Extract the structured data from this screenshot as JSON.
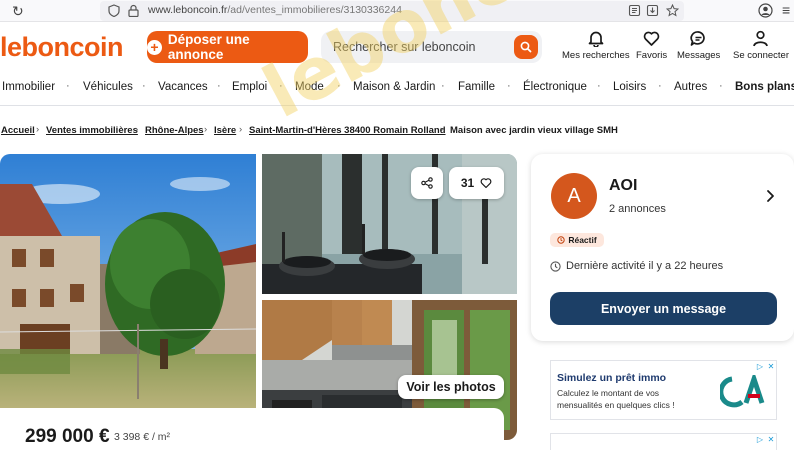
{
  "browser": {
    "url_host": "www.leboncoin.fr",
    "url_path": "/ad/ventes_immobilieres/3130336244"
  },
  "header": {
    "logo": "leboncoin",
    "post_button": "Déposer une annonce",
    "search_placeholder": "Rechercher sur leboncoin",
    "nav": {
      "searches": "Mes recherches",
      "favorites": "Favoris",
      "messages": "Messages",
      "login": "Se connecter"
    }
  },
  "categories": [
    "Immobilier",
    "Véhicules",
    "Vacances",
    "Emploi",
    "Mode",
    "Maison & Jardin",
    "Famille",
    "Électronique",
    "Loisirs",
    "Autres",
    "Bons plans !"
  ],
  "breadcrumb": [
    "Accueil",
    "Ventes immobilières",
    "Rhône-Alpes",
    "Isère",
    "Saint-Martin-d'Hères 38400 Romain Rolland",
    "Maison avec jardin vieux village SMH"
  ],
  "gallery": {
    "favorites_count": "31",
    "see_photos": "Voir les photos"
  },
  "listing": {
    "price": "299 000 €",
    "price_per_m2": "3 398 € / m²"
  },
  "seller": {
    "avatar_letter": "A",
    "name": "AOI",
    "ads_count": "2 annonces",
    "badge": "Réactif",
    "last_activity": "Dernière activité il y a 22 heures",
    "message_button": "Envoyer un message"
  },
  "ad": {
    "title": "Simulez un prêt immo",
    "text": "Calculez le montant de vos mensualités en quelques clics !"
  },
  "watermark": "leboncoin.net",
  "colors": {
    "brand": "#ec5a13",
    "primary_button": "#1c3f66"
  }
}
